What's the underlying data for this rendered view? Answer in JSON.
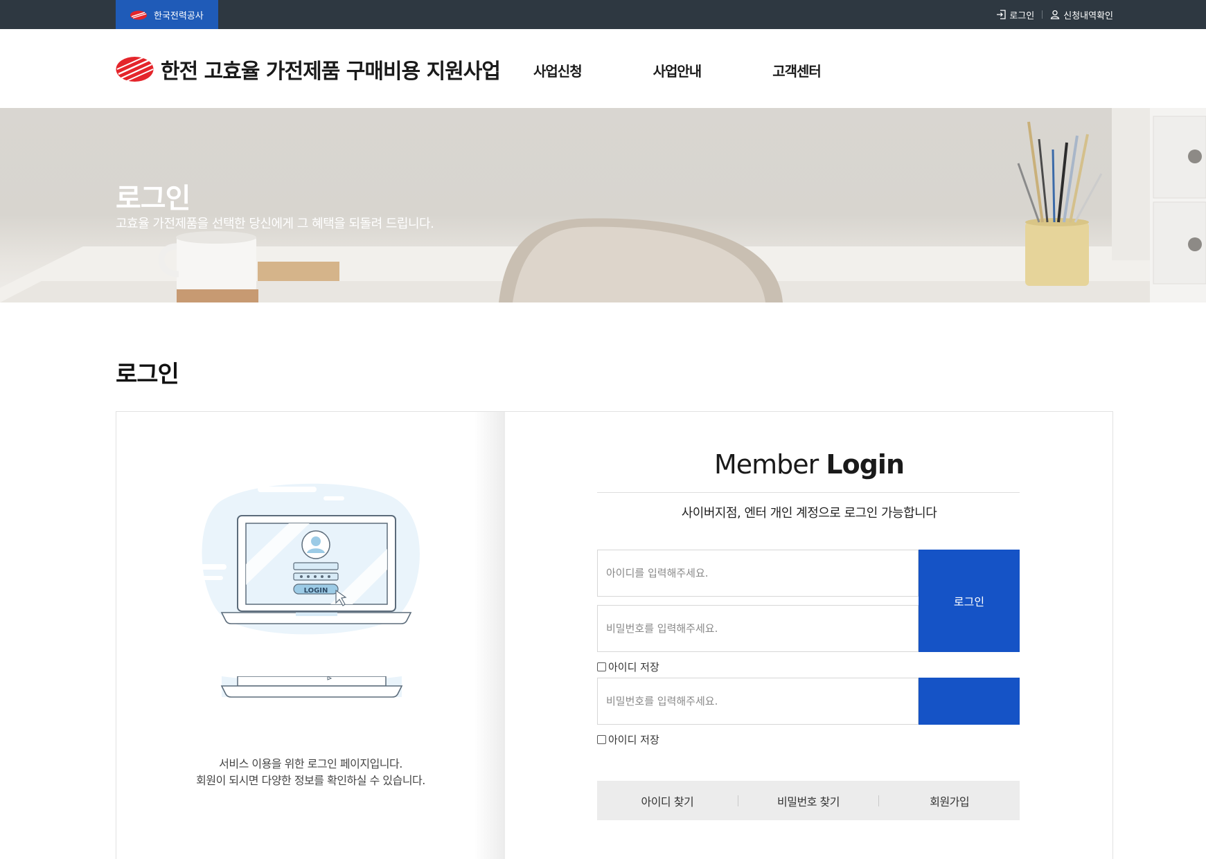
{
  "topbar": {
    "org_label": "한국전력공사",
    "login_label": "로그인",
    "history_label": "신청내역확인"
  },
  "header": {
    "site_title": "한전 고효율 가전제품 구매비용 지원사업",
    "nav": [
      "사업신청",
      "사업안내",
      "고객센터"
    ]
  },
  "banner": {
    "title": "로그인",
    "subtitle": "고효율 가전제품을 선택한 당신에게 그 혜택을 되돌려 드립니다."
  },
  "page": {
    "title": "로그인"
  },
  "left_panel": {
    "illustration_button_text": "LOGIN",
    "desc_line1": "서비스 이용을 위한 로그인 페이지입니다.",
    "desc_line2": "회원이 되시면 다양한 정보를 확인하실 수 있습니다."
  },
  "login_form": {
    "title_light": "Member",
    "title_bold": "Login",
    "description": "사이버지점, 엔터 개인 계정으로 로그인 가능합니다",
    "id_placeholder": "아이디를 입력해주세요.",
    "pw_placeholder": "비밀번호를 입력해주세요.",
    "login_button": "로그인",
    "save_id_label": "아이디 저장",
    "dup_pw_placeholder": "비밀번호를 입력해주세요.",
    "dup_save_id_label": "아이디 저장"
  },
  "footer_links": [
    "아이디 찾기",
    "비밀번호 찾기",
    "회원가입"
  ],
  "colors": {
    "topbar": "#2e3841",
    "brand_blue": "#1553c6",
    "kepco_tab": "#1f5bb8",
    "logo_red": "#e4252b"
  }
}
